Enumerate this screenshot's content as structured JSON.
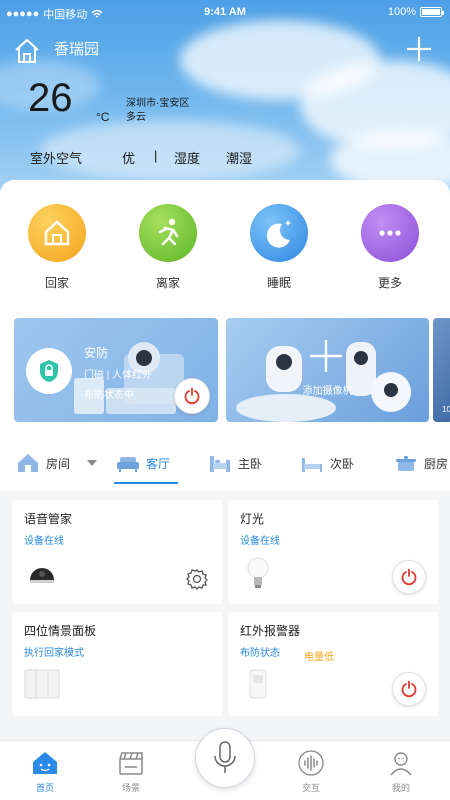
{
  "status_bar": {
    "carrier": "中国移动",
    "time": "9:41 AM",
    "battery": "100%"
  },
  "header": {
    "home_name": "香瑞园",
    "temperature": "26",
    "temperature_unit": "°C",
    "location": "深圳市·宝安区",
    "weather": "多云",
    "air_label": "室外空气",
    "air_value": "优",
    "separator": "|",
    "humidity_label": "湿度",
    "humidity_value": "潮湿"
  },
  "modes": [
    {
      "label": "回家",
      "color": "#f7b12e",
      "icon": "home-icon"
    },
    {
      "label": "离家",
      "color": "#79c93b",
      "icon": "running-icon"
    },
    {
      "label": "睡眠",
      "color": "#3f95ea",
      "icon": "moon-icon"
    },
    {
      "label": "更多",
      "color": "#9b5ee0",
      "icon": "more-icon"
    }
  ],
  "banners": {
    "security": {
      "title": "安防",
      "line1": "门磁 | 人体红外",
      "line2": "布防状态中"
    },
    "camera": {
      "label": "添加摄像机"
    },
    "third": {
      "label": "10"
    }
  },
  "rooms": {
    "dropdown_label": "房间",
    "tabs": [
      {
        "label": "客厅",
        "active": true
      },
      {
        "label": "主卧",
        "active": false
      },
      {
        "label": "次卧",
        "active": false
      },
      {
        "label": "厨房",
        "active": false
      }
    ]
  },
  "devices": [
    {
      "name": "语音管家",
      "state": "设备在线",
      "icon": "smart-speaker-icon",
      "control": "settings-icon"
    },
    {
      "name": "灯光",
      "state": "设备在线",
      "icon": "light-bulb-icon",
      "control": "power-icon"
    },
    {
      "name": "四位情景面板",
      "state": "执行回家模式",
      "icon": "switch-panel-icon",
      "control": "none"
    },
    {
      "name": "红外报警器",
      "state": "布防状态",
      "extra": "电量低",
      "icon": "infrared-sensor-icon",
      "control": "power-icon"
    }
  ],
  "bottom_nav": [
    {
      "label": "首页",
      "active": true
    },
    {
      "label": "场景",
      "active": false
    },
    {
      "label": "交互",
      "active": false
    },
    {
      "label": "我的",
      "active": false
    }
  ],
  "colors": {
    "accent": "#2a8ae6",
    "power_red": "#e0392b",
    "warning": "#f2a41c"
  }
}
